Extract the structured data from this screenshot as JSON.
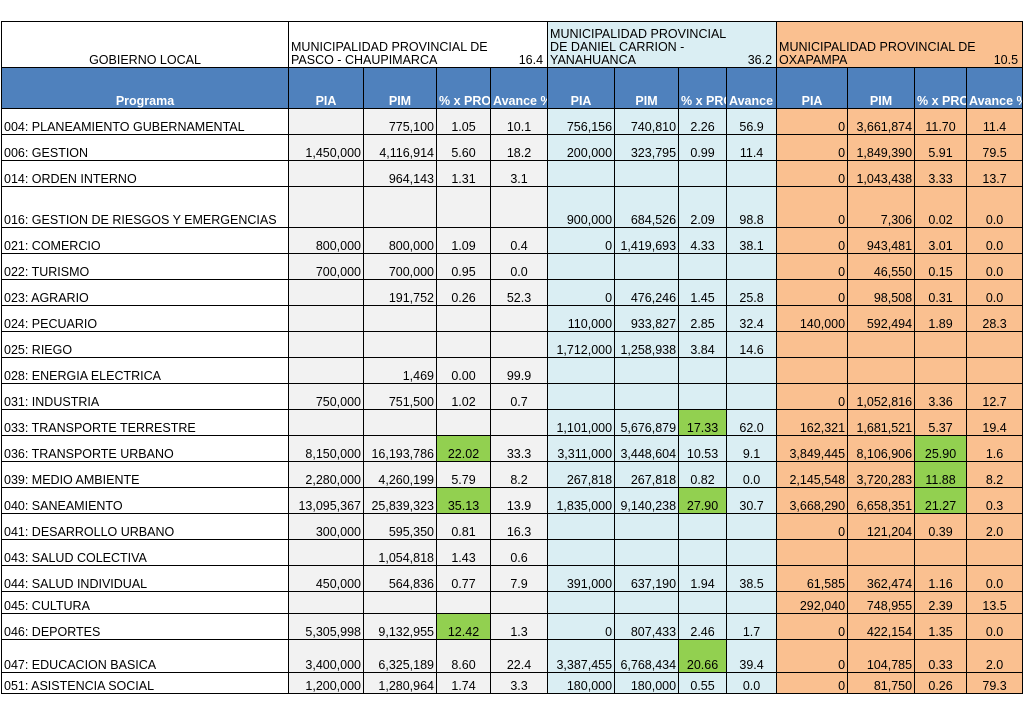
{
  "header": {
    "gobierno_label": "GOBIERNO LOCAL",
    "groups": [
      {
        "name": "MUNICIPALIDAD PROVINCIAL DE PASCO - CHAUPIMARCA",
        "avance": "16.4"
      },
      {
        "name": "MUNICIPALIDAD PROVINCIAL DE DANIEL CARRION - YANAHUANCA",
        "avance": "36.2"
      },
      {
        "name": "MUNICIPALIDAD PROVINCIAL DE OXAPAMPA",
        "avance": "10.5"
      }
    ],
    "col_programa": "Programa",
    "col_pia": "PIA",
    "col_pim": "PIM",
    "col_prog": "% x PROG",
    "col_avance": "Avance %"
  },
  "colors": {
    "header_blue": "#4f81bd",
    "group1_bg": "#f2f2f2",
    "group2_bg": "#daeef3",
    "group3_bg": "#fac090",
    "highlight_green": "#92d050"
  },
  "rows": [
    {
      "programa": "004: PLANEAMIENTO GUBERNAMENTAL",
      "c": [
        "",
        "775,100",
        "1.05",
        "10.1",
        "756,156",
        "740,810",
        "2.26",
        "56.9",
        "0",
        "3,661,874",
        "11.70",
        "11.4"
      ],
      "hl": []
    },
    {
      "programa": "006: GESTION",
      "c": [
        "1,450,000",
        "4,116,914",
        "5.60",
        "18.2",
        "200,000",
        "323,795",
        "0.99",
        "11.4",
        "0",
        "1,849,390",
        "5.91",
        "79.5"
      ],
      "hl": []
    },
    {
      "programa": "014: ORDEN INTERNO",
      "c": [
        "",
        "964,143",
        "1.31",
        "3.1",
        "",
        "",
        "",
        "",
        "0",
        "1,043,438",
        "3.33",
        "13.7"
      ],
      "hl": []
    },
    {
      "programa": "016: GESTION DE RIESGOS Y EMERGENCIAS",
      "c": [
        "",
        "",
        "",
        "",
        "900,000",
        "684,526",
        "2.09",
        "98.8",
        "0",
        "7,306",
        "0.02",
        "0.0"
      ],
      "hl": []
    },
    {
      "programa": "021: COMERCIO",
      "c": [
        "800,000",
        "800,000",
        "1.09",
        "0.4",
        "0",
        "1,419,693",
        "4.33",
        "38.1",
        "0",
        "943,481",
        "3.01",
        "0.0"
      ],
      "hl": []
    },
    {
      "programa": "022: TURISMO",
      "c": [
        "700,000",
        "700,000",
        "0.95",
        "0.0",
        "",
        "",
        "",
        "",
        "0",
        "46,550",
        "0.15",
        "0.0"
      ],
      "hl": []
    },
    {
      "programa": "023: AGRARIO",
      "c": [
        "",
        "191,752",
        "0.26",
        "52.3",
        "0",
        "476,246",
        "1.45",
        "25.8",
        "0",
        "98,508",
        "0.31",
        "0.0"
      ],
      "hl": []
    },
    {
      "programa": "024: PECUARIO",
      "c": [
        "",
        "",
        "",
        "",
        "110,000",
        "933,827",
        "2.85",
        "32.4",
        "140,000",
        "592,494",
        "1.89",
        "28.3"
      ],
      "hl": []
    },
    {
      "programa": "025: RIEGO",
      "c": [
        "",
        "",
        "",
        "",
        "1,712,000",
        "1,258,938",
        "3.84",
        "14.6",
        "",
        "",
        "",
        ""
      ],
      "hl": []
    },
    {
      "programa": "028: ENERGIA ELECTRICA",
      "c": [
        "",
        "1,469",
        "0.00",
        "99.9",
        "",
        "",
        "",
        "",
        "",
        "",
        "",
        ""
      ],
      "hl": []
    },
    {
      "programa": "031: INDUSTRIA",
      "c": [
        "750,000",
        "751,500",
        "1.02",
        "0.7",
        "",
        "",
        "",
        "",
        "0",
        "1,052,816",
        "3.36",
        "12.7"
      ],
      "hl": []
    },
    {
      "programa": "033: TRANSPORTE TERRESTRE",
      "c": [
        "",
        "",
        "",
        "",
        "1,101,000",
        "5,676,879",
        "17.33",
        "62.0",
        "162,321",
        "1,681,521",
        "5.37",
        "19.4"
      ],
      "hl": [
        6
      ]
    },
    {
      "programa": "036: TRANSPORTE URBANO",
      "c": [
        "8,150,000",
        "16,193,786",
        "22.02",
        "33.3",
        "3,311,000",
        "3,448,604",
        "10.53",
        "9.1",
        "3,849,445",
        "8,106,906",
        "25.90",
        "1.6"
      ],
      "hl": [
        2,
        10
      ]
    },
    {
      "programa": "039: MEDIO AMBIENTE",
      "c": [
        "2,280,000",
        "4,260,199",
        "5.79",
        "8.2",
        "267,818",
        "267,818",
        "0.82",
        "0.0",
        "2,145,548",
        "3,720,283",
        "11.88",
        "8.2"
      ],
      "hl": [
        10
      ]
    },
    {
      "programa": "040: SANEAMIENTO",
      "c": [
        "13,095,367",
        "25,839,323",
        "35.13",
        "13.9",
        "1,835,000",
        "9,140,238",
        "27.90",
        "30.7",
        "3,668,290",
        "6,658,351",
        "21.27",
        "0.3"
      ],
      "hl": [
        2,
        6,
        10
      ]
    },
    {
      "programa": "041: DESARROLLO URBANO",
      "c": [
        "300,000",
        "595,350",
        "0.81",
        "16.3",
        "",
        "",
        "",
        "",
        "0",
        "121,204",
        "0.39",
        "2.0"
      ],
      "hl": []
    },
    {
      "programa": "043: SALUD COLECTIVA",
      "c": [
        "",
        "1,054,818",
        "1.43",
        "0.6",
        "",
        "",
        "",
        "",
        "",
        "",
        "",
        ""
      ],
      "hl": []
    },
    {
      "programa": "044: SALUD INDIVIDUAL",
      "c": [
        "450,000",
        "564,836",
        "0.77",
        "7.9",
        "391,000",
        "637,190",
        "1.94",
        "38.5",
        "61,585",
        "362,474",
        "1.16",
        "0.0"
      ],
      "hl": []
    },
    {
      "programa": "045: CULTURA",
      "c": [
        "",
        "",
        "",
        "",
        "",
        "",
        "",
        "",
        "292,040",
        "748,955",
        "2.39",
        "13.5"
      ],
      "hl": []
    },
    {
      "programa": "046: DEPORTES",
      "c": [
        "5,305,998",
        "9,132,955",
        "12.42",
        "1.3",
        "0",
        "807,433",
        "2.46",
        "1.7",
        "0",
        "422,154",
        "1.35",
        "0.0"
      ],
      "hl": [
        2
      ]
    },
    {
      "programa": "047: EDUCACION BASICA",
      "c": [
        "3,400,000",
        "6,325,189",
        "8.60",
        "22.4",
        "3,387,455",
        "6,768,434",
        "20.66",
        "39.4",
        "0",
        "104,785",
        "0.33",
        "2.0"
      ],
      "hl": [
        6
      ]
    },
    {
      "programa": "051: ASISTENCIA SOCIAL",
      "c": [
        "1,200,000",
        "1,280,964",
        "1.74",
        "3.3",
        "180,000",
        "180,000",
        "0.55",
        "0.0",
        "0",
        "81,750",
        "0.26",
        "79.3"
      ],
      "hl": []
    }
  ]
}
